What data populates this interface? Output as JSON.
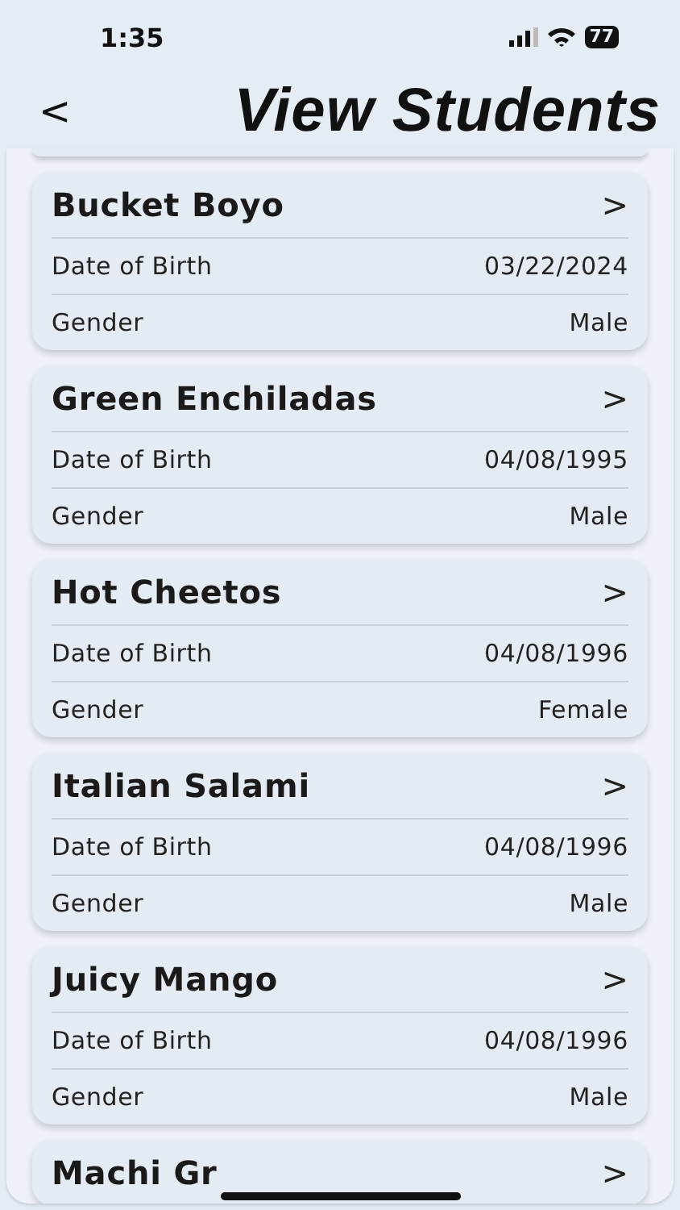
{
  "status_bar": {
    "time": "1:35",
    "battery": "77"
  },
  "header": {
    "back": "<",
    "title": "View Students"
  },
  "students": [
    {
      "name": "Bucket Boyo",
      "chevron": ">",
      "fields": [
        {
          "label": "Date of Birth",
          "value": "03/22/2024"
        },
        {
          "label": "Gender",
          "value": "Male"
        }
      ]
    },
    {
      "name": "Green Enchiladas",
      "chevron": ">",
      "fields": [
        {
          "label": "Date of Birth",
          "value": "04/08/1995"
        },
        {
          "label": "Gender",
          "value": "Male"
        }
      ]
    },
    {
      "name": "Hot Cheetos",
      "chevron": ">",
      "fields": [
        {
          "label": "Date of Birth",
          "value": "04/08/1996"
        },
        {
          "label": "Gender",
          "value": "Female"
        }
      ]
    },
    {
      "name": "Italian Salami",
      "chevron": ">",
      "fields": [
        {
          "label": "Date of Birth",
          "value": "04/08/1996"
        },
        {
          "label": "Gender",
          "value": "Male"
        }
      ]
    },
    {
      "name": "Juicy Mango",
      "chevron": ">",
      "fields": [
        {
          "label": "Date of Birth",
          "value": "04/08/1996"
        },
        {
          "label": "Gender",
          "value": "Male"
        }
      ]
    },
    {
      "name": "Machi Gr",
      "chevron": ">"
    }
  ]
}
